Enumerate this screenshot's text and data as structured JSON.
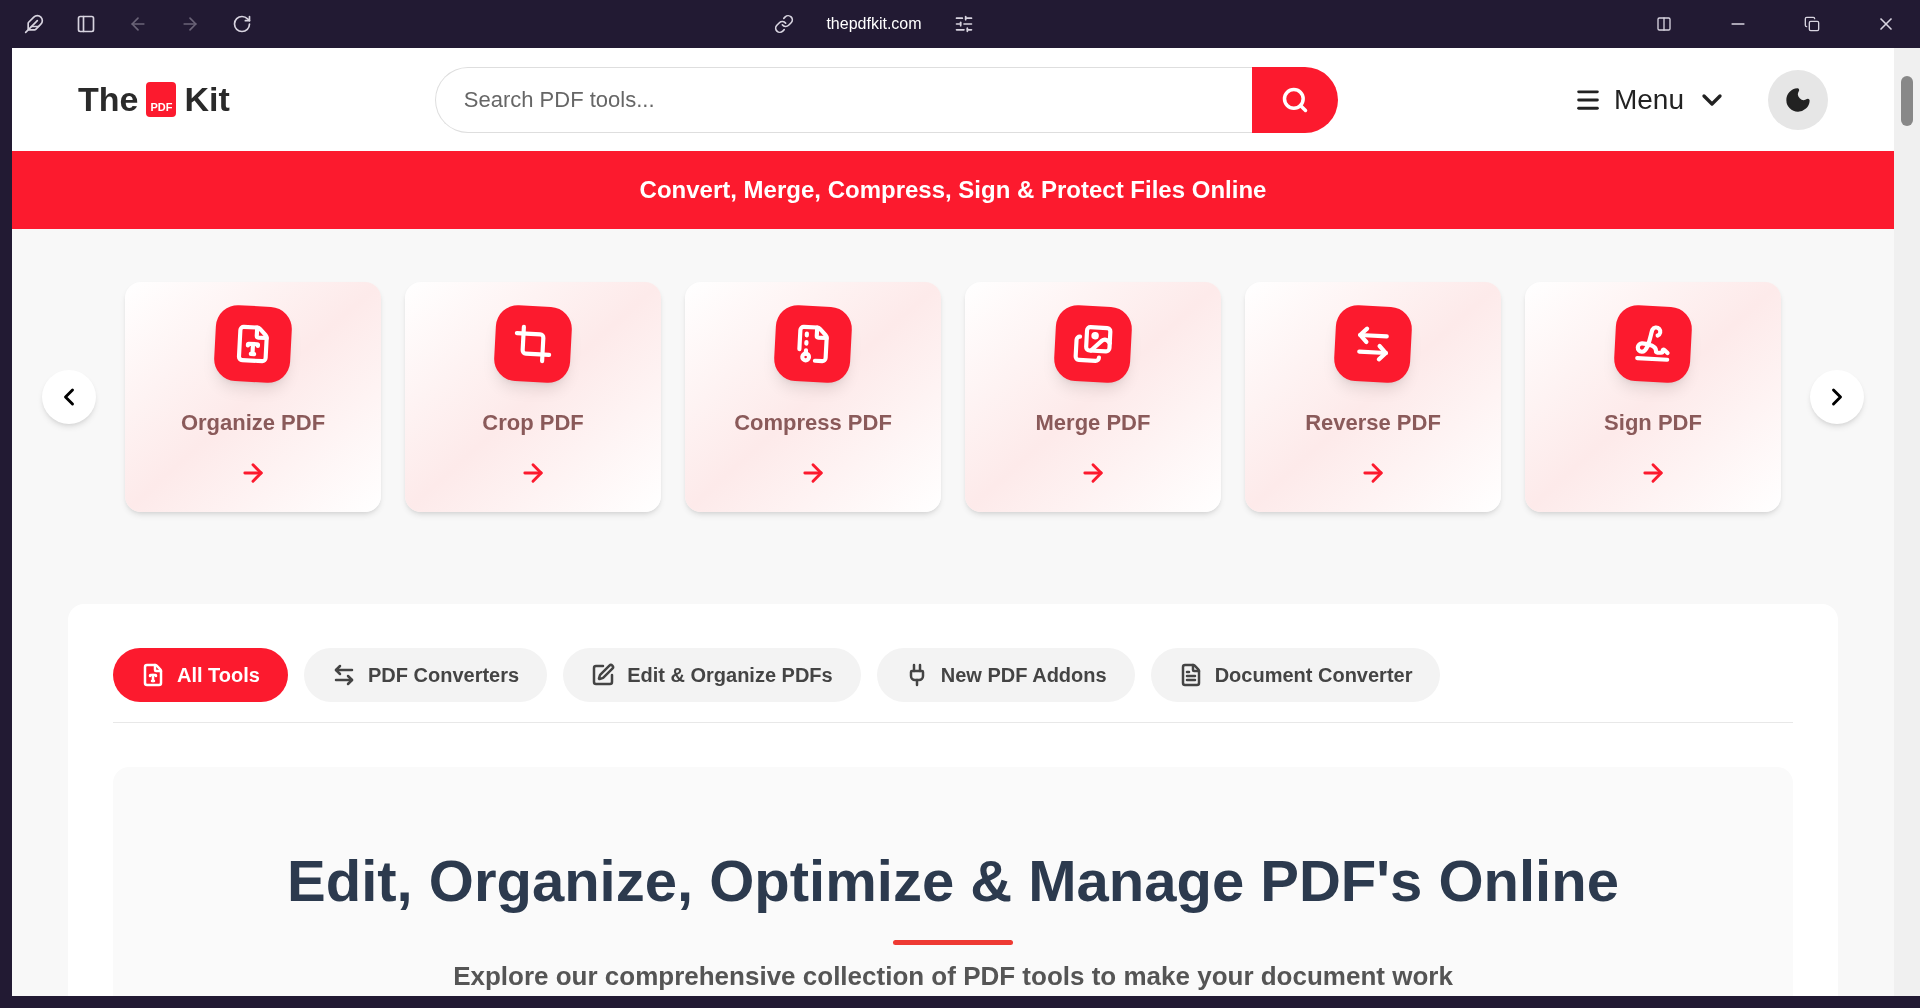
{
  "browser": {
    "url": "thepdfkit.com"
  },
  "header": {
    "logo_left": "The",
    "logo_badge": "PDF",
    "logo_right": "Kit",
    "search": {
      "placeholder": "Search PDF tools..."
    },
    "menu": "Menu"
  },
  "banner": "Convert, Merge, Compress, Sign & Protect Files Online",
  "carousel": [
    {
      "kind": "organize",
      "label": "Organize PDF"
    },
    {
      "kind": "crop",
      "label": "Crop PDF"
    },
    {
      "kind": "compress",
      "label": "Compress PDF"
    },
    {
      "kind": "merge",
      "label": "Merge PDF"
    },
    {
      "kind": "reverse",
      "label": "Reverse PDF"
    },
    {
      "kind": "sign",
      "label": "Sign PDF"
    }
  ],
  "tabs": [
    {
      "kind": "pdf",
      "label": "All Tools",
      "selected": true
    },
    {
      "kind": "convert",
      "label": "PDF Converters",
      "selected": false
    },
    {
      "kind": "edit",
      "label": "Edit & Organize PDFs",
      "selected": false
    },
    {
      "kind": "plug",
      "label": "New PDF Addons",
      "selected": false
    },
    {
      "kind": "doc",
      "label": "Document Converter",
      "selected": false
    }
  ],
  "hero": {
    "title": "Edit, Organize, Optimize & Manage PDF's Online",
    "subtitle": "Explore our comprehensive collection of PDF tools to make your document work"
  }
}
